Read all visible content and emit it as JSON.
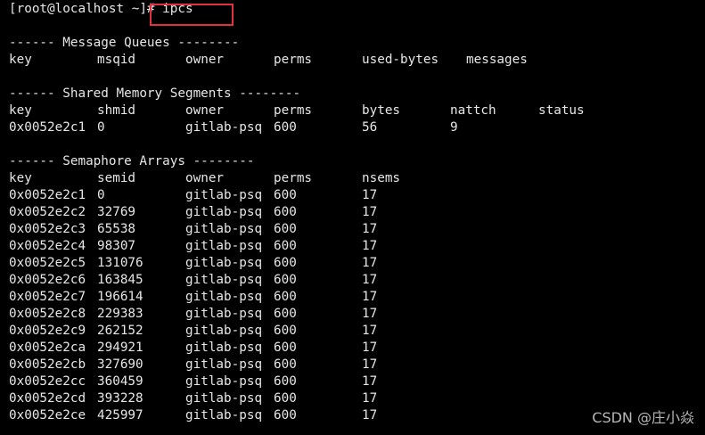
{
  "terminal": {
    "prompt": "[root@localhost ~]# ",
    "command": "ipcs",
    "message_queues": {
      "header": "------ Message Queues --------",
      "columns": [
        "key",
        "msqid",
        "owner",
        "perms",
        "used-bytes",
        "messages"
      ],
      "rows": []
    },
    "shared_memory": {
      "header": "------ Shared Memory Segments --------",
      "columns": [
        "key",
        "shmid",
        "owner",
        "perms",
        "bytes",
        "nattch",
        "status"
      ],
      "rows": [
        [
          "0x0052e2c1",
          "0",
          "gitlab-psq",
          "600",
          "56",
          "9",
          ""
        ]
      ]
    },
    "semaphore_arrays": {
      "header": "------ Semaphore Arrays --------",
      "columns": [
        "key",
        "semid",
        "owner",
        "perms",
        "nsems"
      ],
      "rows": [
        [
          "0x0052e2c1",
          "0",
          "gitlab-psq",
          "600",
          "17"
        ],
        [
          "0x0052e2c2",
          "32769",
          "gitlab-psq",
          "600",
          "17"
        ],
        [
          "0x0052e2c3",
          "65538",
          "gitlab-psq",
          "600",
          "17"
        ],
        [
          "0x0052e2c4",
          "98307",
          "gitlab-psq",
          "600",
          "17"
        ],
        [
          "0x0052e2c5",
          "131076",
          "gitlab-psq",
          "600",
          "17"
        ],
        [
          "0x0052e2c6",
          "163845",
          "gitlab-psq",
          "600",
          "17"
        ],
        [
          "0x0052e2c7",
          "196614",
          "gitlab-psq",
          "600",
          "17"
        ],
        [
          "0x0052e2c8",
          "229383",
          "gitlab-psq",
          "600",
          "17"
        ],
        [
          "0x0052e2c9",
          "262152",
          "gitlab-psq",
          "600",
          "17"
        ],
        [
          "0x0052e2ca",
          "294921",
          "gitlab-psq",
          "600",
          "17"
        ],
        [
          "0x0052e2cb",
          "327690",
          "gitlab-psq",
          "600",
          "17"
        ],
        [
          "0x0052e2cc",
          "360459",
          "gitlab-psq",
          "600",
          "17"
        ],
        [
          "0x0052e2cd",
          "393228",
          "gitlab-psq",
          "600",
          "17"
        ],
        [
          "0x0052e2ce",
          "425997",
          "gitlab-psq",
          "600",
          "17"
        ]
      ]
    }
  },
  "watermark": "CSDN @庄小焱",
  "colors": {
    "background": "#000000",
    "text": "#e6e6e6",
    "highlight": "#e0313f",
    "watermark": "#b7b7b7"
  }
}
